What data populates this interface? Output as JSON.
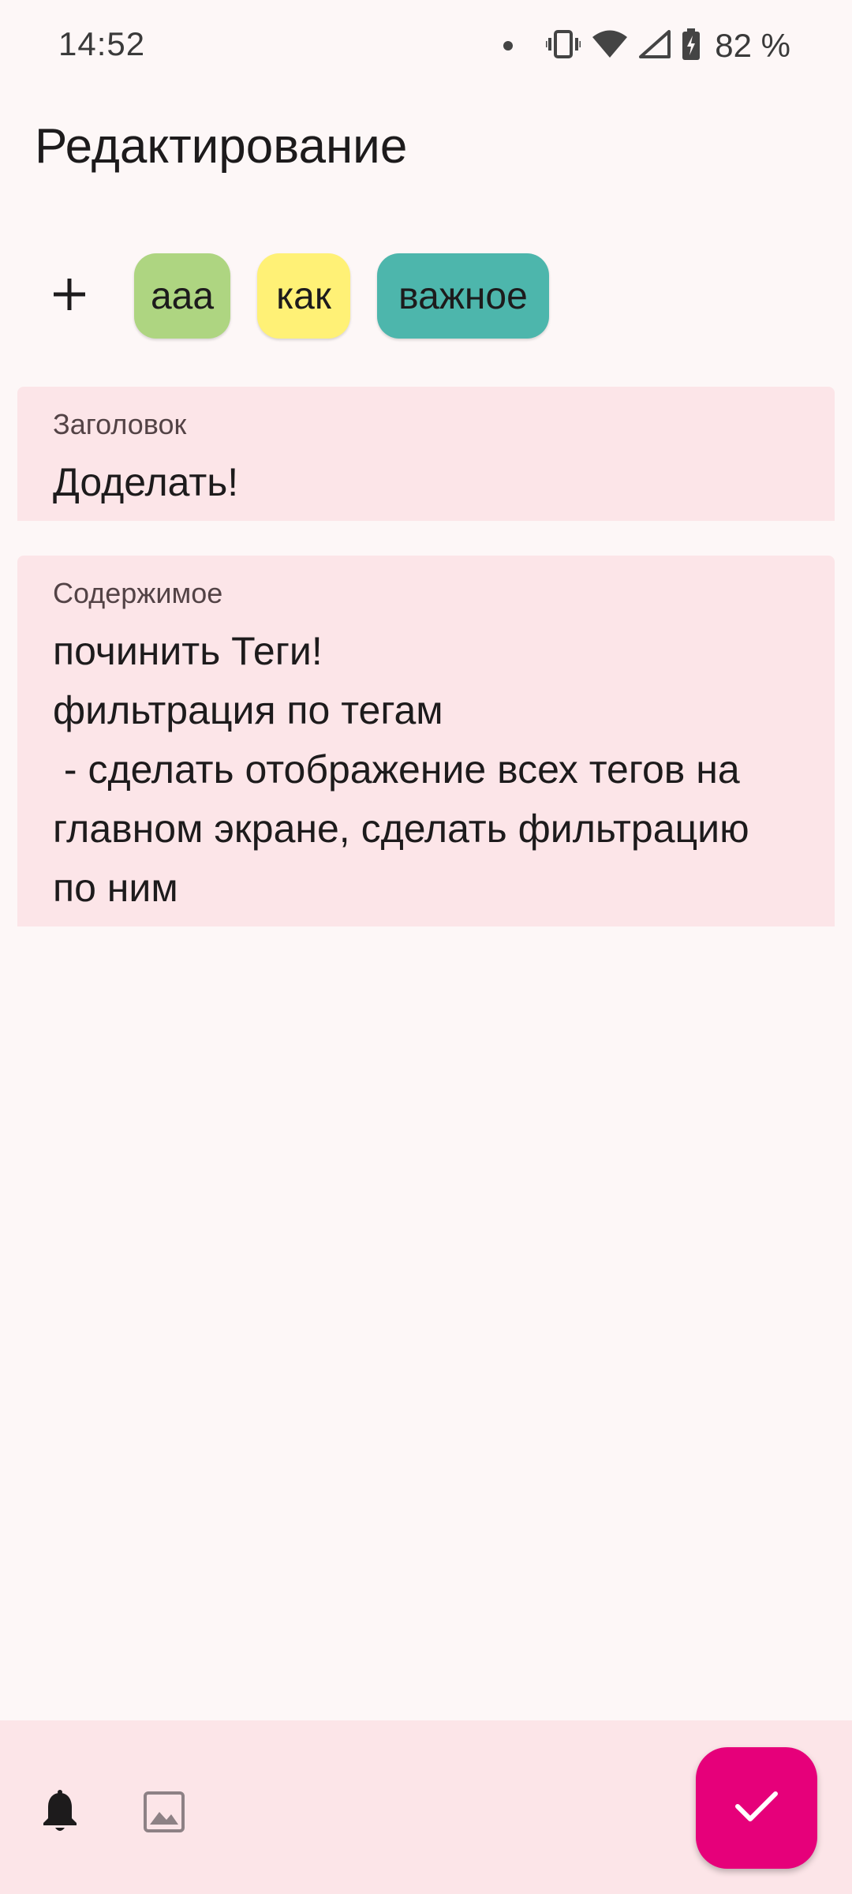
{
  "status_bar": {
    "time": "14:52",
    "battery_percent": "82 %",
    "icons": [
      "notification-dot-icon",
      "vibrate-icon",
      "wifi-icon",
      "cellular-signal-icon",
      "battery-charging-icon"
    ]
  },
  "app_bar": {
    "title": "Редактирование"
  },
  "tags": {
    "add_icon": "plus-icon",
    "chips": [
      {
        "label": "aaa",
        "color": "#aed581"
      },
      {
        "label": "как",
        "color": "#fff176"
      },
      {
        "label": "важное",
        "color": "#4db6ac"
      }
    ]
  },
  "fields": {
    "title": {
      "label": "Заголовок",
      "value": "Доделать!"
    },
    "content": {
      "label": "Содержимое",
      "value": "починить Теги!\nфильтрация по тегам\n - сделать отображение всех тегов на главном экране, сделать фильтрацию по ним"
    }
  },
  "bottom_bar": {
    "icons": [
      "bell-icon",
      "image-icon"
    ],
    "fab_icon": "check-icon",
    "fab_color": "#e6007a"
  },
  "colors": {
    "background": "#fdf7f7",
    "field_background": "#fce5e8"
  }
}
